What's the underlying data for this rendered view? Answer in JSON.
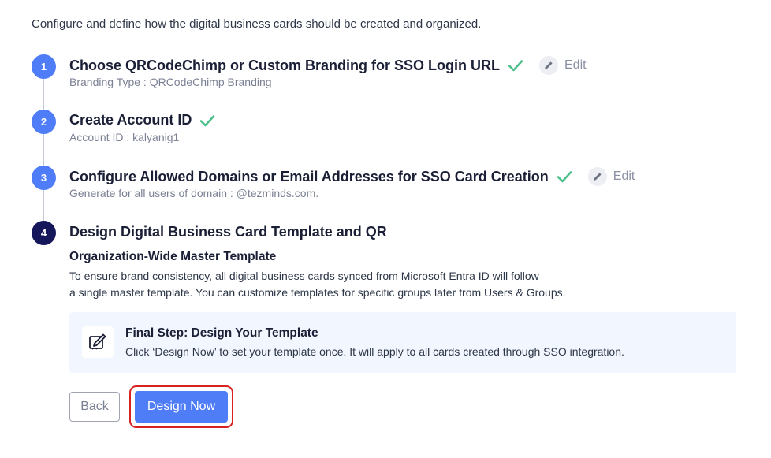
{
  "intro": "Configure and define how the digital business cards should be created and organized.",
  "steps": [
    {
      "number": "1",
      "title": "Choose QRCodeChimp or Custom Branding for SSO Login URL",
      "subtitle": "Branding Type : QRCodeChimp Branding",
      "completed": true,
      "edit_label": "Edit"
    },
    {
      "number": "2",
      "title": "Create Account ID",
      "subtitle": "Account ID : kalyanig1",
      "completed": true
    },
    {
      "number": "3",
      "title": "Configure Allowed Domains or Email Addresses for SSO Card Creation",
      "subtitle": "Generate for all users of domain : @tezminds.com.",
      "completed": true,
      "edit_label": "Edit"
    },
    {
      "number": "4",
      "title": "Design Digital Business Card Template and QR",
      "completed": false
    }
  ],
  "template_section": {
    "title": "Organization-Wide Master Template",
    "line1": "To ensure brand consistency, all digital business cards synced from Microsoft Entra ID will follow",
    "line2": "a single master template. You can customize templates for specific groups later from Users & Groups."
  },
  "banner": {
    "icon": "edit-template-icon",
    "title": "Final Step: Design Your Template",
    "text": "Click ‘Design Now’ to set your template once. It will apply to all cards created through SSO integration."
  },
  "buttons": {
    "back": "Back",
    "design_now": "Design Now"
  },
  "colors": {
    "primary": "#4f7cf7",
    "active_step": "#16165a",
    "check": "#4cc08a",
    "highlight": "#d62222",
    "banner_bg": "#f2f6fe"
  }
}
